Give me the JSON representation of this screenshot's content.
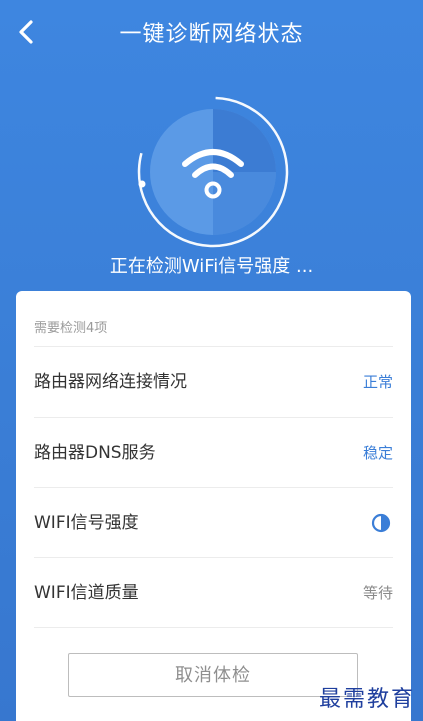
{
  "header": {
    "title": "一键诊断网络状态",
    "back_icon": "chevron-left-icon"
  },
  "scanner": {
    "icon": "wifi-icon",
    "status_text": "正在检测WiFi信号强度 ..."
  },
  "card": {
    "section_label": "需要检测4项",
    "items": [
      {
        "label": "路由器网络连接情况",
        "status": "正常"
      },
      {
        "label": "路由器DNS服务",
        "status": "稳定"
      },
      {
        "label": "WIFI信号强度",
        "status": "",
        "icon": "loading-icon"
      },
      {
        "label": "WIFI信道质量",
        "status": "等待"
      }
    ],
    "cancel_label": "取消体检"
  },
  "watermark": "最需教育",
  "colors": {
    "background": "#3a7ed6",
    "accent": "#3b7ed7",
    "card": "#ffffff"
  }
}
